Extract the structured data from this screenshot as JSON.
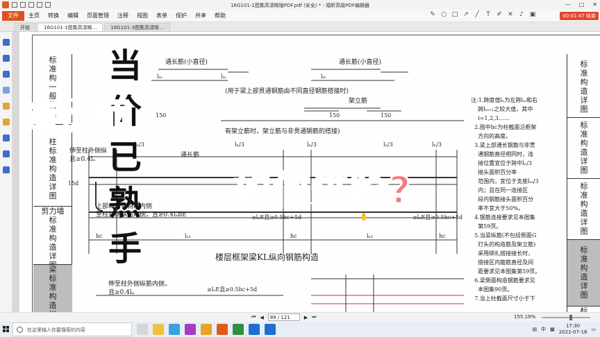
{
  "titlebar": {
    "title": "16G101-1图集高清晰版PDF.pdf (安全) * - 福昕高级PDF编辑器",
    "window_controls": [
      "—",
      "□",
      "✕"
    ]
  },
  "menubar": {
    "file": "文件",
    "items": [
      "主页",
      "转换",
      "编辑",
      "页面管理",
      "注释",
      "视图",
      "表单",
      "保护",
      "共享",
      "帮助"
    ],
    "recording_badge": "00:01:47 结束"
  },
  "tabs": [
    {
      "label": "开始",
      "active": false
    },
    {
      "label": "16G101-1图集高清晰...",
      "active": true
    },
    {
      "label": "16G101-3图集高清晰...",
      "active": false
    }
  ],
  "left_headings": [
    {
      "lines": [
        "标",
        "准",
        "构",
        "一",
        "般",
        "构",
        "造"
      ]
    },
    {
      "lines": [
        "柱",
        "标",
        "准",
        "构",
        "造",
        "详",
        "图"
      ]
    },
    {
      "lines": [
        "剪力墙",
        "标",
        "准",
        "构",
        "造",
        "详",
        "图"
      ]
    },
    {
      "lines": [
        "梁",
        "标",
        "准",
        "构",
        "造",
        "详",
        "图"
      ]
    },
    {
      "lines": [
        "标"
      ]
    }
  ],
  "right_headings": [
    {
      "lines": [
        "标",
        "准",
        "构",
        "造",
        "详",
        "图"
      ]
    },
    {
      "lines": [
        "标",
        "准",
        "构",
        "造",
        "详",
        "图"
      ]
    },
    {
      "lines": [
        "标",
        "准",
        "构",
        "造",
        "详",
        "图"
      ]
    },
    {
      "lines": [
        "标",
        "准",
        "构",
        "造",
        "详",
        "图"
      ]
    },
    {
      "lines": [
        "标"
      ]
    }
  ],
  "drawing": {
    "label_tongchang_small_1": "通长筋(小直径)",
    "label_tongchang_small_2": "通长筋(小直径)",
    "lle_1": "lₗₑ",
    "lle_2": "lₗₑ",
    "lle_3": "lₗₑ",
    "note_splice_diff": "(用于梁上部贯通钢筋由不同直径钢筋搭接时)",
    "label_jialijin": "架立筋",
    "dim_150_1": "150",
    "dim_150_2": "150",
    "dim_150_3": "150",
    "note_jialijin_splice": "有架立筋时，架立筋与非贯通钢筋的搭接)",
    "note_column_outer": "伸至柱外侧纵",
    "note_column_outer_2": "且≥0.4lₐ",
    "label_tongchang": "通长筋",
    "ln3_1": "lₙ/3",
    "ln3_2": "lₙ/3",
    "ln3_3": "lₙ/3",
    "ln3_4": "lₙ/3",
    "ln3_5": "lₙ/3",
    "label_15d": "15d",
    "note_upper_bent_1": "上部纵筋弯钩段内侧",
    "note_upper_bent_2": "至柱外侧纵筋内侧，且≥0.4lₐbE",
    "dim_lae_1": "≥lₐE且≥0.5hc+5d",
    "dim_lae_2": "≥lₐE且≥0.5hc+5d",
    "hc_1": "hc",
    "hc_2": "hc",
    "hc_3": "hc",
    "ln1": "lₙ₁",
    "ln2": "lₙ₂",
    "main_title": "楼层框架梁KL纵向钢筋构造",
    "note_bottom_1": "伸至柱外侧纵筋内侧，",
    "note_bottom_2": "且≥0.4lₐ",
    "dim_lae_3": "≥lₐE且≥0.5hc+5d"
  },
  "notes": {
    "lines": [
      "注:1.跨度值lₙ为左跨lₙᵢ和右",
      "    跨lₙᵢ₊₁之较大值，其中",
      "    i=1,2,3……",
      "  2.图中hc为柱截面沿框架",
      "    方向的高度。",
      "  3.梁上部通长钢筋与非贯",
      "    通钢筋直径相同时，连",
      "    接位置宜位于跨中lₙ/3",
      "    接头面积百分率",
      "    范围内，宜位于支座lₙᵢ/3",
      "    内；且在同一连接区",
      "    段内钢筋接头面积百分",
      "    率不宜大于50%。",
      "  4.钢筋连接要求见本图集",
      "    第59页。",
      "  5.当梁纵筋(不包括侧面G",
      "    打头的构造筋及架立筋)",
      "    采用绑扎搭接接长时，",
      "    搭接区内箍筋直径及间",
      "    距要求见本图集第59页。",
      "  6.梁侧面构造钢筋要求见",
      "    本图集90页。",
      "  7.当上柱截面尺寸小于下"
    ]
  },
  "overlays": {
    "main": "造价师",
    "right": "如何进阶?",
    "vertical": [
      "当",
      "价",
      "已",
      "熟",
      "手"
    ]
  },
  "statusbar": {
    "page": "89 / 121",
    "zoom": "155.19%"
  },
  "taskbar": {
    "search_placeholder": "在这里输入你要搜索的内容",
    "ime": "中",
    "time": "17:30",
    "date": "2021-07-18"
  },
  "colors": {
    "brand": "#d9531e",
    "overlay_main": "#f39a57",
    "overlay_right": "#f17d7f",
    "badge": "#e4452e"
  }
}
